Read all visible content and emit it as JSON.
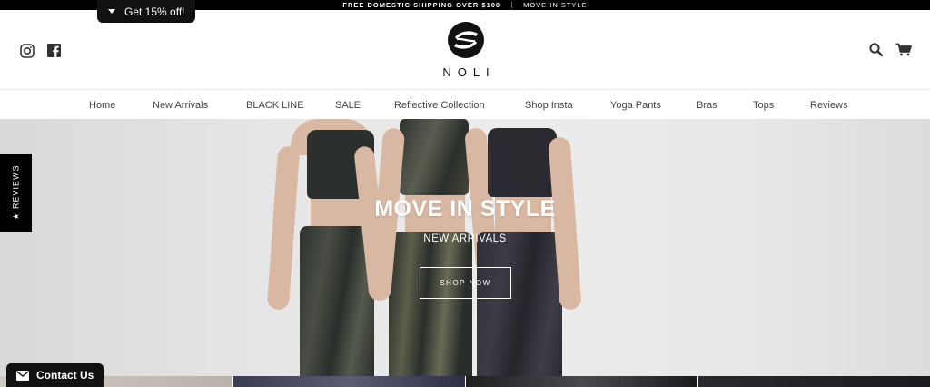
{
  "announcement": {
    "shipping": "FREE DOMESTIC SHIPPING OVER $100",
    "tagline": "MOVE IN STYLE"
  },
  "discount_tab": {
    "label": "Get 15% off!"
  },
  "brand": {
    "name": "NOLI"
  },
  "social": {
    "icons": [
      "instagram-icon",
      "facebook-icon"
    ]
  },
  "header_actions": {
    "icons": [
      "search-icon",
      "cart-icon"
    ]
  },
  "nav": {
    "items": [
      {
        "label": "Home"
      },
      {
        "label": "New Arrivals"
      },
      {
        "label": "BLACK LINE"
      },
      {
        "label": "SALE"
      },
      {
        "label": "Reflective Collection"
      },
      {
        "label": "Shop Insta"
      },
      {
        "label": "Yoga Pants"
      },
      {
        "label": "Bras"
      },
      {
        "label": "Tops"
      },
      {
        "label": "Reviews"
      }
    ]
  },
  "hero": {
    "title": "MOVE IN STYLE",
    "subtitle": "NEW ARRIVALS",
    "button": "SHOP NOW"
  },
  "reviews_tab": {
    "label": "★ REVIEWS"
  },
  "contact": {
    "label": "Contact Us"
  }
}
